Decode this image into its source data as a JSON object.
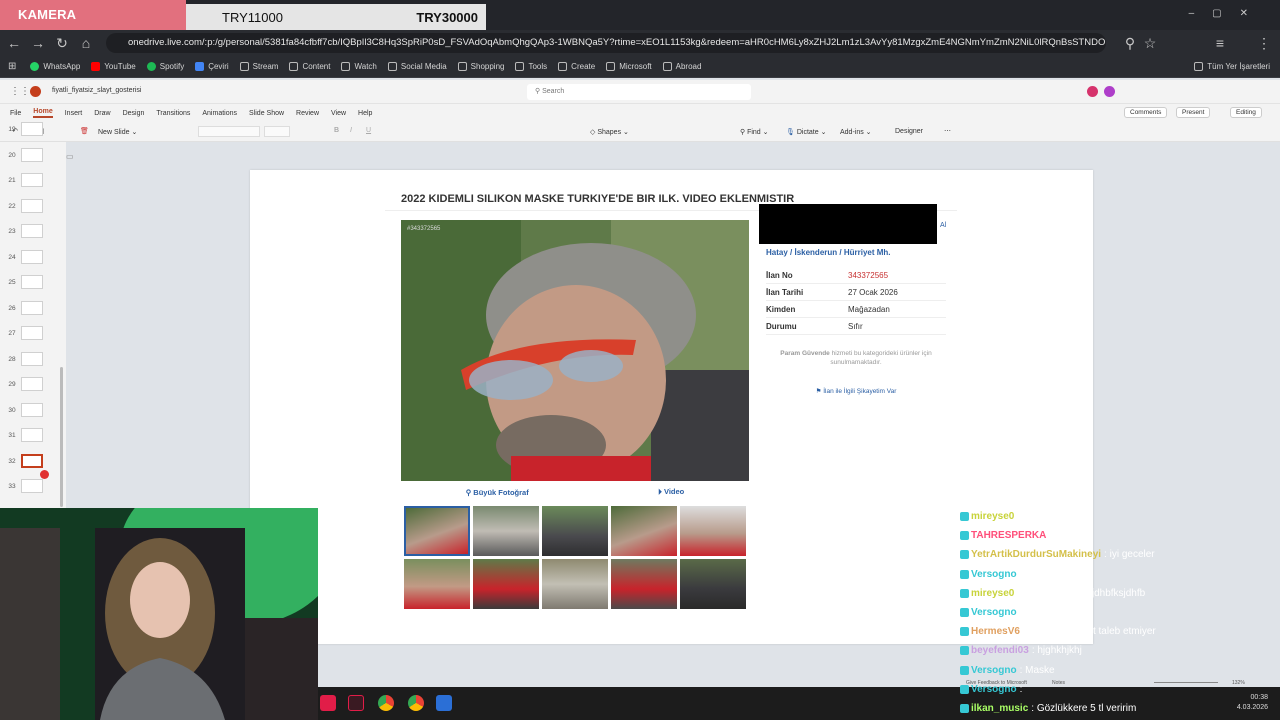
{
  "overlay": {
    "camera_label": "KAMERA",
    "goal_left": "TRY11000",
    "goal_right": "TRY30000"
  },
  "browser": {
    "url": "onedrive.live.com/:p:/g/personal/5381fa84cfbff7cb/IQBpIl3C8Hq3SpRiP0sD_FSVAdOqAbmQhgQAp3-1WBNQa5Y?rtime=xEO1L1153kg&redeem=aHR0cHM6Ly8xZHJ2Lm1zL3AvYy81MzgxZmE4NGNmYmZmN2NiL0lRQnBsSTNDOEhxM1Nw...",
    "bookmarks": [
      {
        "label": "WhatsApp",
        "icon": "whatsapp-icon",
        "color": "#25d366"
      },
      {
        "label": "YouTube",
        "icon": "youtube-icon",
        "color": "#ff0000"
      },
      {
        "label": "Spotify",
        "icon": "spotify-icon",
        "color": "#1db954"
      },
      {
        "label": "Çeviri",
        "icon": "translate-icon",
        "color": "#4285f4"
      },
      {
        "label": "Stream",
        "icon": "folder-icon",
        "color": ""
      },
      {
        "label": "Content",
        "icon": "folder-icon",
        "color": ""
      },
      {
        "label": "Watch",
        "icon": "folder-icon",
        "color": ""
      },
      {
        "label": "Social Media",
        "icon": "folder-icon",
        "color": ""
      },
      {
        "label": "Shopping",
        "icon": "folder-icon",
        "color": ""
      },
      {
        "label": "Tools",
        "icon": "folder-icon",
        "color": ""
      },
      {
        "label": "Create",
        "icon": "folder-icon",
        "color": ""
      },
      {
        "label": "Microsoft",
        "icon": "folder-icon",
        "color": ""
      },
      {
        "label": "Abroad",
        "icon": "folder-icon",
        "color": ""
      }
    ],
    "all_bookmarks": "Tüm Yer İşaretleri"
  },
  "powerpoint": {
    "file_name": "fiyatli_fiyatsiz_slayt_gosterisi",
    "search_placeholder": "Search",
    "menu": [
      "File",
      "Home",
      "Insert",
      "Draw",
      "Design",
      "Transitions",
      "Animations",
      "Slide Show",
      "Review",
      "View",
      "Help"
    ],
    "active_menu": "Home",
    "comments": "Comments",
    "present": "Present",
    "editing": "Editing",
    "ribbon": {
      "new_slide": "New Slide",
      "shapes": "Shapes",
      "find": "Find",
      "dictate": "Dictate",
      "addins": "Add-ins",
      "designer": "Designer"
    },
    "slide_numbers": [
      "19",
      "20",
      "21",
      "22",
      "23",
      "24",
      "25",
      "26",
      "27",
      "28",
      "29",
      "30",
      "31",
      "32",
      "33"
    ],
    "selected_slide": "32",
    "feedback": "Give Feedback to Microsoft",
    "notes": "Notes",
    "zoom": "132%"
  },
  "listing": {
    "title": "2022 KIDEMLI SILIKON MASKE TURKIYE'DE BIR ILK. VIDEO EKLENMISTIR",
    "photo_id": "#343372565",
    "big_photo": "Büyük Fotoğraf",
    "video": "Video",
    "breadcrumb": [
      "Hatay",
      "İskenderun",
      "Hürriyet Mh."
    ],
    "partial_label": "Al",
    "details": [
      {
        "key": "İlan No",
        "value": "343372565"
      },
      {
        "key": "İlan Tarihi",
        "value": "27 Ocak 2026"
      },
      {
        "key": "Kimden",
        "value": "Mağazadan"
      },
      {
        "key": "Durumu",
        "value": "Sıfır"
      }
    ],
    "safe_pay_bold": "Param Güvende",
    "safe_pay_note": " hizmeti bu kategorideki ürünler için sunulmamaktadır.",
    "report": "İlan ile İlgili Şikayetim Var"
  },
  "chat": [
    {
      "user": "mireyse0",
      "text": ": iyi geceler",
      "color": "#c8d33a"
    },
    {
      "user": "TAHRESPERKA",
      "text": ":",
      "color": "#ff4f7a"
    },
    {
      "user": "YetrArtikDurdurSuMakineyi",
      "text": ": iyi geceler",
      "color": "#d4c04a"
    },
    {
      "user": "Versogno",
      "text": ":",
      "color": "#36c8d4"
    },
    {
      "user": "mireyse0",
      "text": ": sikdjfjuksjdhfjksjdhbfksjdhfb",
      "color": "#c8d33a"
    },
    {
      "user": "Versogno",
      "text": ":",
      "color": "#36c8d4"
    },
    {
      "user": "HermesV6",
      "text": ": 0 değil mi iferst taleb etmiyer",
      "color": "#e0a060"
    },
    {
      "user": "beyefendi03",
      "text": ": hjghkhjkhj",
      "color": "#c9a0e0"
    },
    {
      "user": "Versogno",
      "text": ": Maske",
      "color": "#36c8d4"
    },
    {
      "user": "Versogno",
      "text": ":",
      "color": "#36c8d4"
    },
    {
      "user": "ilkan_music",
      "text": ": Gözlükkere 5 tl veririm",
      "color": "#aaff66"
    }
  ],
  "clock": {
    "time": "00:38",
    "date": "4.03.2026"
  }
}
